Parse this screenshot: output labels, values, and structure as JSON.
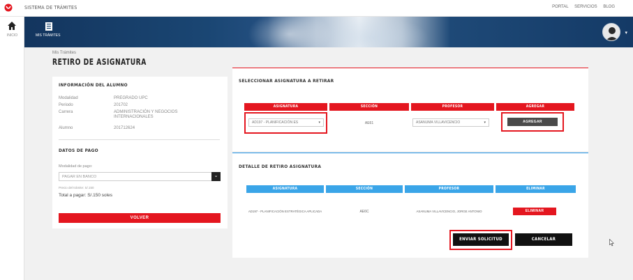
{
  "topbar": {
    "app_title": "SISTEMA DE TRÁMITES",
    "links": [
      "PORTAL",
      "SERVICIOS",
      "BLOG"
    ]
  },
  "rail": {
    "home_label": "INICIO"
  },
  "banner": {
    "section_label": "MIS TRÁMITES"
  },
  "breadcrumb": "Mis Trámites",
  "page_title": "RETIRO DE ASIGNATURA",
  "student_info": {
    "heading": "INFORMACIÓN DEL ALUMNO",
    "rows": [
      {
        "key": "Modalidad",
        "value": "PREGRADO UPC"
      },
      {
        "key": "Periodo",
        "value": "201702"
      },
      {
        "key": "Carrera",
        "value": "ADMINISTRACIÓN Y NEGOCIOS INTERNACIONALES"
      },
      {
        "key": "Alumno",
        "value": "201712624"
      }
    ]
  },
  "payment": {
    "heading": "DATOS DE PAGO",
    "mode_label": "Modalidad de pago:",
    "mode_value": "PAGAR EN BANCO",
    "fee_label": "Precio del trámite: S/.150",
    "total_label": "Total a pagar: S/.150 soles",
    "back_button": "VOLVER"
  },
  "select_section": {
    "heading": "SELECCIONAR ASIGNATURA A RETIRAR",
    "columns": [
      "ASIGNATURA",
      "SECCIÓN",
      "PROFESOR",
      "AGREGAR"
    ],
    "course_value": "AD197 - PLANIFICACIÓN ES",
    "section_value": "AE61",
    "professor_value": "ASANUMA VILLAVICENCIO",
    "add_button": "AGREGAR"
  },
  "detail_section": {
    "heading": "DETALLE DE RETIRO ASIGNATURA",
    "columns": [
      "ASIGNATURA",
      "SECCIÓN",
      "PROFESOR",
      "ELIMINAR"
    ],
    "rows": [
      {
        "course": "AD197 - PLANIFICACIÓN ESTRATÉGICA APLICADA",
        "section": "AE6C",
        "professor": "ASANUMA VILLAVICENCIO, JORGE ANTONIO",
        "remove": "ELIMINAR"
      }
    ],
    "submit_button": "ENVIAR SOLICITUD",
    "cancel_button": "CANCELAR"
  },
  "colors": {
    "brand_red": "#e4161f",
    "accent_blue": "#3aa5e8",
    "banner_navy": "#13355e"
  }
}
